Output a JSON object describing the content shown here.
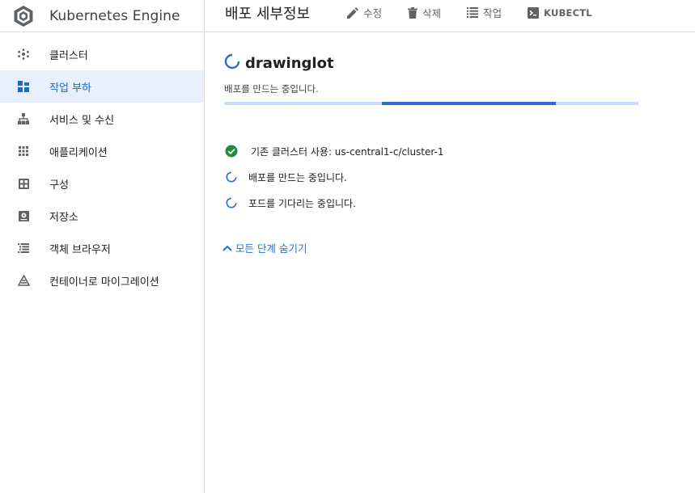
{
  "brand": {
    "title": "Kubernetes Engine"
  },
  "sidebar": {
    "items": [
      {
        "label": "클러스터",
        "icon": "cluster-icon",
        "active": false
      },
      {
        "label": "작업 부하",
        "icon": "workloads-icon",
        "active": true
      },
      {
        "label": "서비스 및 수신",
        "icon": "services-icon",
        "active": false
      },
      {
        "label": "애플리케이션",
        "icon": "applications-icon",
        "active": false
      },
      {
        "label": "구성",
        "icon": "configuration-icon",
        "active": false
      },
      {
        "label": "저장소",
        "icon": "storage-icon",
        "active": false
      },
      {
        "label": "객체 브라우저",
        "icon": "object-browser-icon",
        "active": false
      },
      {
        "label": "컨테이너로 마이그레이션",
        "icon": "migrate-icon",
        "active": false
      }
    ]
  },
  "toolbar": {
    "title": "배포 세부정보",
    "edit_label": "수정",
    "delete_label": "삭제",
    "actions_label": "작업",
    "kubectl_label": "KUBECTL"
  },
  "deployment": {
    "name": "drawinglot",
    "status": "배포를 만드는 중입니다.",
    "progress": {
      "indeterminate": true,
      "segment_start": 0.38,
      "segment_end": 0.8
    }
  },
  "steps": [
    {
      "label": "기존 클러스터 사용: us-central1-c/cluster-1",
      "state": "done"
    },
    {
      "label": "배포를 만드는 중입니다.",
      "state": "pending"
    },
    {
      "label": "포드를 기다리는 중입니다.",
      "state": "pending"
    }
  ],
  "toggle": {
    "label": "모든 단계 숨기기"
  },
  "colors": {
    "accent": "#1a73e8",
    "active_bg": "#e8f0fe",
    "progress_track": "#c6dafc",
    "progress_fill": "#3367d6",
    "success": "#1e8e3e"
  }
}
